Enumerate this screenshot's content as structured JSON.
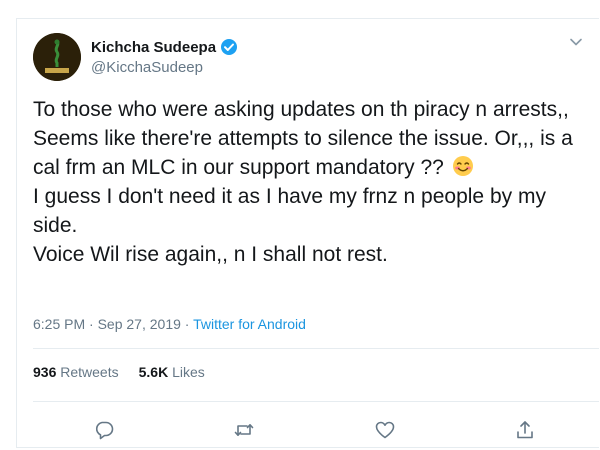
{
  "user": {
    "display_name": "Kichcha Sudeepa",
    "handle": "@KicchaSudeep"
  },
  "tweet": {
    "lines": [
      "To those who were asking updates on th piracy n arrests,,",
      "Seems like there're attempts to silence the issue. Or,,, is a cal frm an MLC in our support mandatory ??",
      "I guess I don't need it as I have my frnz n people by my side.",
      "Voice Wil rise again,, n I shall not rest."
    ],
    "time": "6:25 PM",
    "separator": "·",
    "date": "Sep 27, 2019",
    "source": "Twitter for Android"
  },
  "stats": {
    "retweets_count": "936",
    "retweets_label": "Retweets",
    "likes_count": "5.6K",
    "likes_label": "Likes"
  },
  "icons": {
    "verified": "verified-badge-icon",
    "caret": "chevron-down-icon",
    "reply": "reply-icon",
    "retweet": "retweet-icon",
    "like": "heart-icon",
    "share": "share-icon",
    "emoji": "smiling-face-with-smiling-eyes"
  },
  "colors": {
    "accent": "#1da1f2",
    "link": "#1b95e0",
    "muted": "#657786",
    "text": "#14171a"
  }
}
